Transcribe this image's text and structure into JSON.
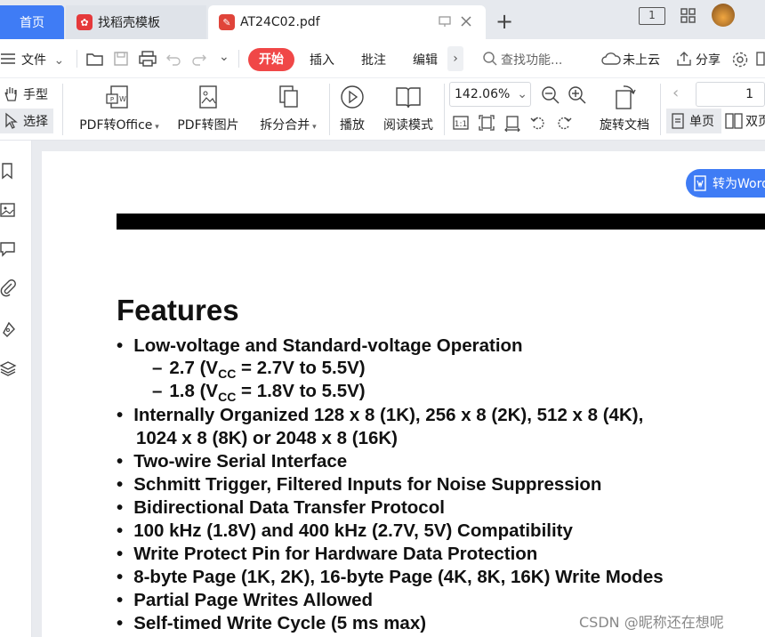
{
  "tabs": [
    {
      "label": "首页"
    },
    {
      "label": "找稻壳模板"
    },
    {
      "label": "AT24C02.pdf"
    }
  ],
  "window_controls": {
    "page_badge": "1"
  },
  "menubar": {
    "file": "文件",
    "start": "开始",
    "insert": "插入",
    "annotate": "批注",
    "edit": "编辑",
    "search_placeholder": "查找功能...",
    "cloud": "未上云",
    "share": "分享"
  },
  "ribbon": {
    "hand": "手型",
    "select": "选择",
    "pdf_to_office": "PDF转Office",
    "pdf_to_image": "PDF转图片",
    "split_merge": "拆分合并",
    "play": "播放",
    "read_mode": "阅读模式",
    "zoom": "142.06%",
    "rotate_doc": "旋转文档",
    "page_number": "1",
    "single_page": "单页",
    "double_page": "双页"
  },
  "convert_button": "转为Word",
  "document": {
    "heading": "Features",
    "items": [
      {
        "bullet": "•",
        "text": "Low-voltage and Standard-voltage Operation"
      },
      {
        "bullet": "–",
        "text_pre": "2.7 (V",
        "sub": "CC",
        "text_post": " = 2.7V to 5.5V)"
      },
      {
        "bullet": "–",
        "text_pre": "1.8 (V",
        "sub": "CC",
        "text_post": " = 1.8V to 5.5V)"
      },
      {
        "bullet": "•",
        "text": "Internally Organized 128 x 8 (1K), 256 x 8 (2K), 512 x 8 (4K),"
      },
      {
        "bullet": "",
        "text": "1024 x 8 (8K) or 2048 x 8 (16K)"
      },
      {
        "bullet": "•",
        "text": "Two-wire Serial Interface"
      },
      {
        "bullet": "•",
        "text": "Schmitt Trigger, Filtered Inputs for Noise Suppression"
      },
      {
        "bullet": "•",
        "text": "Bidirectional Data Transfer Protocol"
      },
      {
        "bullet": "•",
        "text": "100 kHz (1.8V) and 400 kHz (2.7V, 5V) Compatibility"
      },
      {
        "bullet": "•",
        "text": "Write Protect Pin for Hardware Data Protection"
      },
      {
        "bullet": "•",
        "text": "8-byte Page (1K, 2K), 16-byte Page (4K, 8K, 16K) Write Modes"
      },
      {
        "bullet": "•",
        "text": "Partial Page Writes Allowed"
      },
      {
        "bullet": "•",
        "text": "Self-timed Write Cycle (5 ms max)"
      }
    ]
  },
  "watermark": "CSDN @昵称还在想呢",
  "colors": {
    "accent": "#3f7cf5",
    "start": "#f04747",
    "pdf_icon": "#e0443a",
    "template_icon": "#e5393b"
  }
}
